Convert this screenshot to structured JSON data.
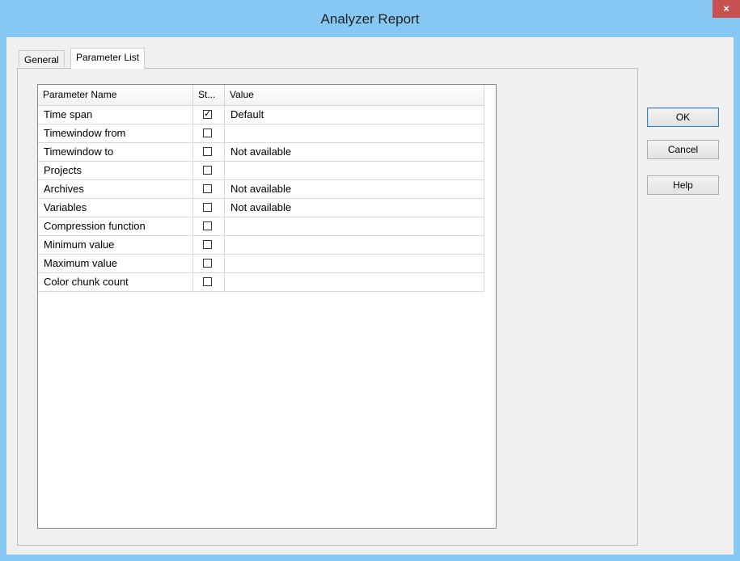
{
  "window": {
    "title": "Analyzer Report",
    "close_glyph": "×"
  },
  "tabs": [
    {
      "label": "General"
    },
    {
      "label": "Parameter List"
    }
  ],
  "list": {
    "columns": [
      "Parameter Name",
      "St...",
      "Value"
    ],
    "rows": [
      {
        "name": "Time span",
        "checked": true,
        "value": "Default"
      },
      {
        "name": "Timewindow from",
        "checked": false,
        "value": ""
      },
      {
        "name": "Timewindow to",
        "checked": false,
        "value": "Not available"
      },
      {
        "name": "Projects",
        "checked": false,
        "value": ""
      },
      {
        "name": "Archives",
        "checked": false,
        "value": "Not available"
      },
      {
        "name": "Variables",
        "checked": false,
        "value": "Not available"
      },
      {
        "name": "Compression function",
        "checked": false,
        "value": ""
      },
      {
        "name": "Minimum value",
        "checked": false,
        "value": ""
      },
      {
        "name": "Maximum value",
        "checked": false,
        "value": ""
      },
      {
        "name": "Color chunk count",
        "checked": false,
        "value": ""
      }
    ]
  },
  "buttons": {
    "ok": "OK",
    "cancel": "Cancel",
    "help": "Help"
  },
  "colors": {
    "titlebar": "#87c7f3",
    "close": "#c75050"
  }
}
